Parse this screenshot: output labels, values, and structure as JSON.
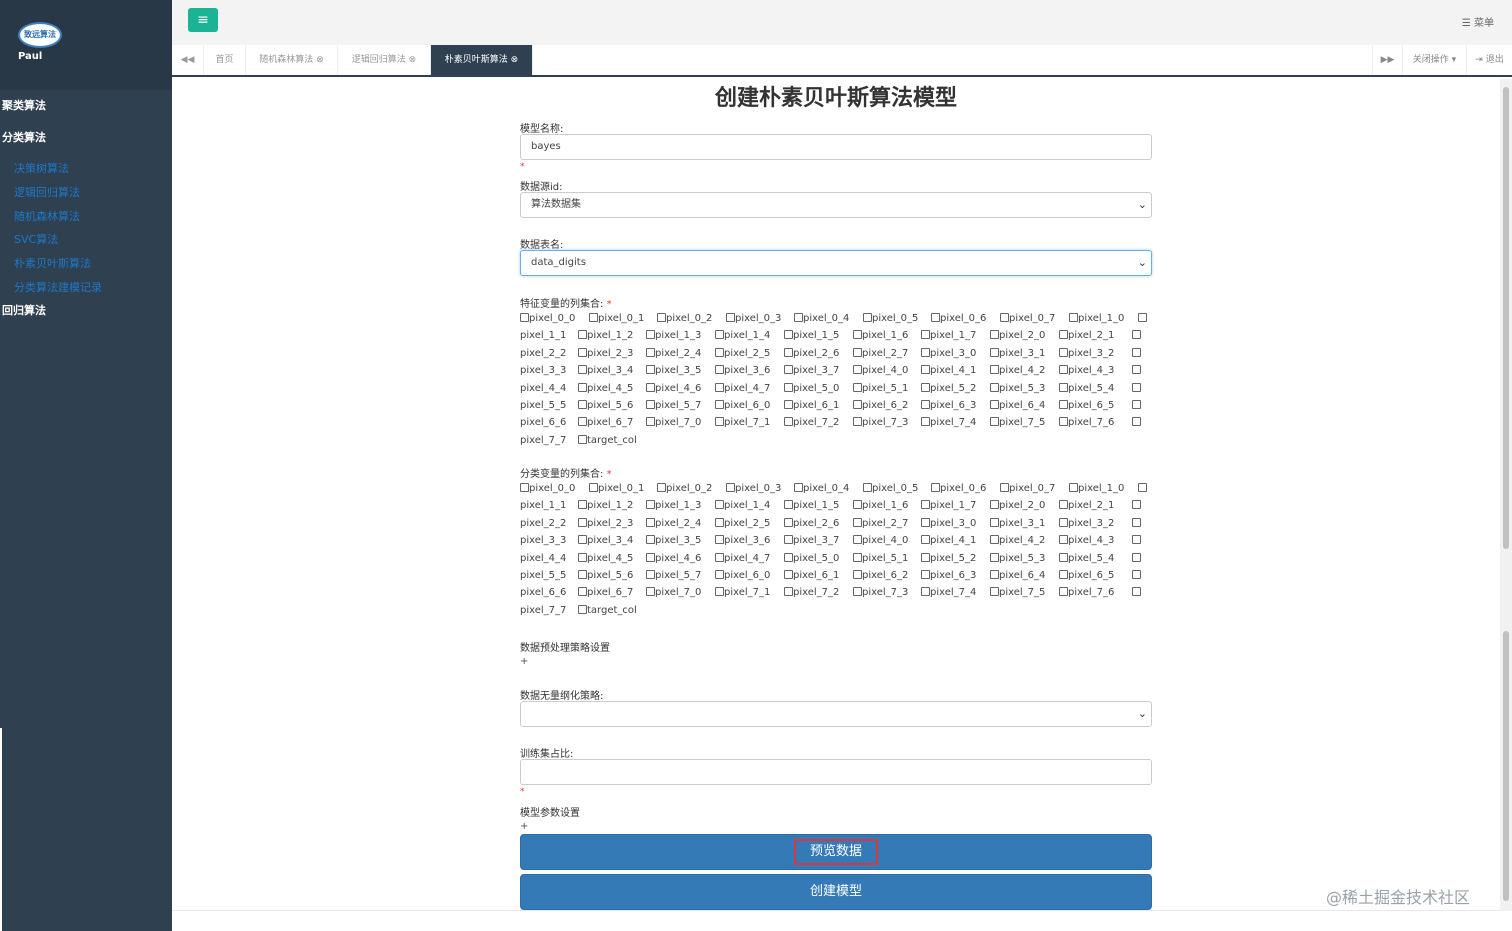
{
  "sidebar": {
    "logo_text": "致远算法",
    "username": "Paul",
    "groups": [
      "聚类算法",
      "分类算法",
      "回归算法"
    ],
    "sub_items": [
      "决策树算法",
      "逻辑回归算法",
      "随机森林算法",
      "SVC算法",
      "朴素贝叶斯算法",
      "分类算法建模记录"
    ]
  },
  "topbar": {
    "toggle_icon": "≡",
    "menu_label": "菜单"
  },
  "tabs": {
    "prev": "◀◀",
    "items": [
      "首页",
      "随机森林算法",
      "逻辑回归算法",
      "朴素贝叶斯算法"
    ],
    "next": "▶▶",
    "close_ops": "关闭操作",
    "logout": "退出"
  },
  "form": {
    "title": "创建朴素贝叶斯算法模型",
    "model_name_label": "模型名称:",
    "model_name_value": "bayes",
    "datasource_label": "数据源id:",
    "datasource_value": "算法数据集",
    "table_label": "数据表名:",
    "table_value": "data_digits",
    "feature_label": "特征变量的列集合:",
    "class_label": "分类变量的列集合:",
    "preprocess_label": "数据预处理策略设置",
    "dimless_label": "数据无量纲化策略:",
    "dimless_value": "",
    "train_label": "训练集占比:",
    "train_value": "",
    "params_label": "模型参数设置",
    "required_mark": "*",
    "plus_mark": "+",
    "preview_button": "预览数据",
    "create_button": "创建模型"
  },
  "columns": [
    "pixel_0_0",
    "pixel_0_1",
    "pixel_0_2",
    "pixel_0_3",
    "pixel_0_4",
    "pixel_0_5",
    "pixel_0_6",
    "pixel_0_7",
    "pixel_1_0",
    "pixel_1_1",
    "pixel_1_2",
    "pixel_1_3",
    "pixel_1_4",
    "pixel_1_5",
    "pixel_1_6",
    "pixel_1_7",
    "pixel_2_0",
    "pixel_2_1",
    "pixel_2_2",
    "pixel_2_3",
    "pixel_2_4",
    "pixel_2_5",
    "pixel_2_6",
    "pixel_2_7",
    "pixel_3_0",
    "pixel_3_1",
    "pixel_3_2",
    "pixel_3_3",
    "pixel_3_4",
    "pixel_3_5",
    "pixel_3_6",
    "pixel_3_7",
    "pixel_4_0",
    "pixel_4_1",
    "pixel_4_2",
    "pixel_4_3",
    "pixel_4_4",
    "pixel_4_5",
    "pixel_4_6",
    "pixel_4_7",
    "pixel_5_0",
    "pixel_5_1",
    "pixel_5_2",
    "pixel_5_3",
    "pixel_5_4",
    "pixel_5_5",
    "pixel_5_6",
    "pixel_5_7",
    "pixel_6_0",
    "pixel_6_1",
    "pixel_6_2",
    "pixel_6_3",
    "pixel_6_4",
    "pixel_6_5",
    "pixel_6_6",
    "pixel_6_7",
    "pixel_7_0",
    "pixel_7_1",
    "pixel_7_2",
    "pixel_7_3",
    "pixel_7_4",
    "pixel_7_5",
    "pixel_7_6",
    "pixel_7_7",
    "target_col"
  ],
  "watermark": "@稀土掘金技术社区",
  "colors": {
    "sidebar": "#2f4050",
    "accent": "#1ab394",
    "primary_button": "#337ab7",
    "highlight_border": "#d9363e"
  }
}
